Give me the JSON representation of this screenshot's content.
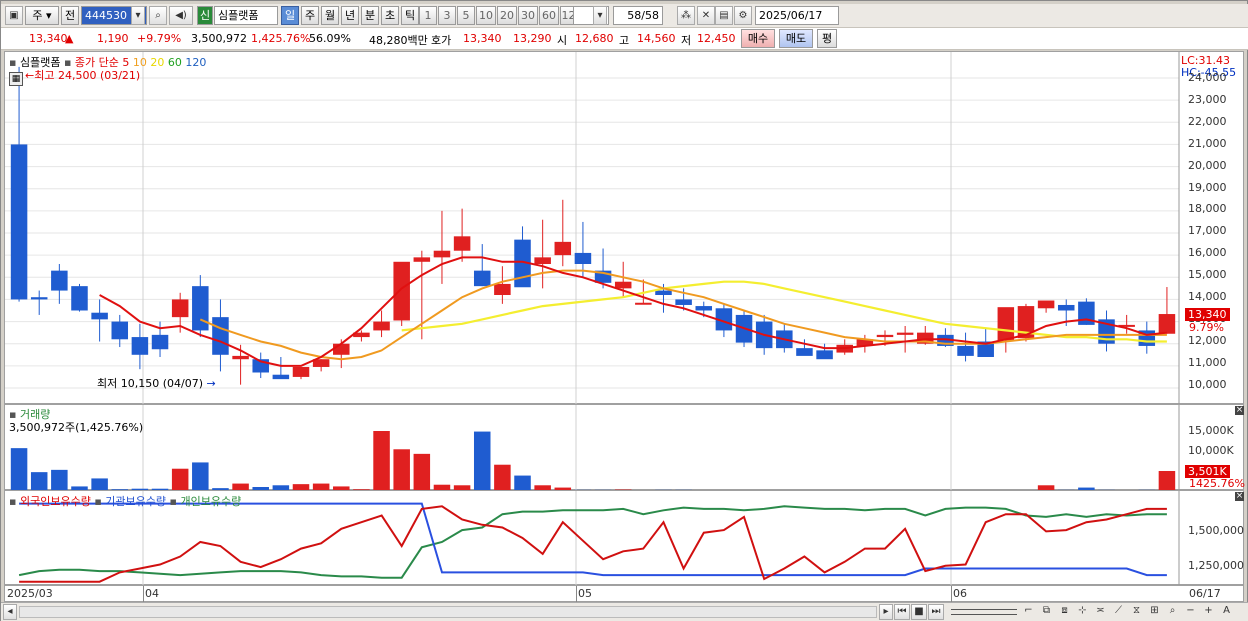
{
  "toolbar": {
    "period_label": "주",
    "prev_label": "전",
    "code": "444530",
    "stock_badge": "신",
    "stock_name": "심플랫폼",
    "period_buttons": [
      "일",
      "주",
      "월",
      "년",
      "분",
      "초",
      "틱"
    ],
    "interval_buttons": [
      "1",
      "3",
      "5",
      "10",
      "20",
      "30",
      "60",
      "120"
    ],
    "count_display": "58/58",
    "date": "2025/06/17"
  },
  "quote": {
    "price": "13,340",
    "change": "1,190",
    "change_pct": "+9.79%",
    "volume": "3,500,972",
    "volume_ratio": "1,425.76%",
    "turnover_ratio": "56.09%",
    "amount": "48,280백만",
    "bid_label": "호가",
    "ask": "13,340",
    "bid": "13,290",
    "open_label": "시",
    "open": "12,680",
    "high_label": "고",
    "high": "14,560",
    "low_label": "저",
    "low": "12,450",
    "buy_button": "매수",
    "sell_button": "매도",
    "eval_button": "평"
  },
  "price_panel": {
    "title": "심플랫폼",
    "legend_prefix": "종가 단순",
    "ma_labels": [
      "5",
      "10",
      "20",
      "60",
      "120"
    ],
    "ma_colors": [
      "#e00000",
      "#f0a020",
      "#f0e020",
      "#20a020",
      "#2060c0"
    ],
    "lc": "LC:31.43",
    "hc": "HC:-45.55",
    "high_note": "최고 24,500 (03/21)",
    "low_note": "최저 10,150 (04/07)",
    "ticks": [
      "24,000",
      "23,000",
      "22,000",
      "21,000",
      "20,000",
      "19,000",
      "18,000",
      "17,000",
      "16,000",
      "15,000",
      "14,000",
      "13,000",
      "12,000",
      "11,000",
      "10,000"
    ],
    "current_tag": "13,340",
    "current_pct": "9.79%"
  },
  "volume_panel": {
    "title": "거래량",
    "value_note": "3,500,972주(1,425.76%)",
    "ticks": [
      "15,000K",
      "10,000K"
    ],
    "current_tag": "3,501K",
    "current_pct": "1425.76%"
  },
  "holdings_panel": {
    "legend": [
      "외국인보유수량",
      "기관보유수량",
      "개인보유수량"
    ],
    "ticks": [
      "1,500,000",
      "1,250,000"
    ]
  },
  "xaxis": {
    "labels": [
      "2025/03",
      "04",
      "05",
      "06"
    ],
    "end_label": "06/17"
  },
  "chart_data": {
    "type": "candlestick",
    "dates": [
      "03/21",
      "03/24",
      "03/25",
      "03/26",
      "03/27",
      "03/28",
      "03/31",
      "04/01",
      "04/02",
      "04/03",
      "04/04",
      "04/07",
      "04/08",
      "04/09",
      "04/10",
      "04/11",
      "04/14",
      "04/15",
      "04/16",
      "04/17",
      "04/18",
      "04/21",
      "04/22",
      "04/23",
      "04/24",
      "04/25",
      "04/28",
      "04/29",
      "04/30",
      "05/02",
      "05/07",
      "05/08",
      "05/09",
      "05/12",
      "05/13",
      "05/14",
      "05/15",
      "05/16",
      "05/19",
      "05/20",
      "05/21",
      "05/22",
      "05/23",
      "05/26",
      "05/27",
      "05/28",
      "05/29",
      "05/30",
      "06/02",
      "06/04",
      "06/05",
      "06/09",
      "06/10",
      "06/11",
      "06/12",
      "06/13",
      "06/16",
      "06/17"
    ],
    "open": [
      21000,
      14100,
      15300,
      14600,
      13400,
      13000,
      12300,
      12400,
      13200,
      14600,
      13200,
      11300,
      11300,
      10600,
      10500,
      10950,
      11500,
      12300,
      12600,
      13050,
      15700,
      15900,
      16200,
      15300,
      14200,
      16700,
      15600,
      16000,
      16100,
      15300,
      14500,
      13800,
      14400,
      14000,
      13700,
      13600,
      13300,
      13000,
      12600,
      11800,
      11700,
      11600,
      11900,
      12300,
      12400,
      12000,
      12400,
      11900,
      12100,
      12150,
      12250,
      13600,
      13750,
      13900,
      13100,
      12850,
      12600,
      12450
    ],
    "high": [
      24500,
      14400,
      15600,
      14700,
      14000,
      13300,
      12900,
      13000,
      14300,
      15100,
      14000,
      11950,
      11600,
      11400,
      10950,
      11300,
      12200,
      12600,
      13500,
      14500,
      16200,
      18000,
      18100,
      16500,
      15500,
      17300,
      17600,
      18500,
      17500,
      16300,
      15700,
      14900,
      14700,
      14500,
      13900,
      13800,
      13500,
      13300,
      12900,
      12200,
      12000,
      12200,
      12400,
      12600,
      12800,
      12800,
      12700,
      12500,
      12700,
      12300,
      13800,
      13900,
      14000,
      14050,
      13500,
      13300,
      13000,
      14560
    ],
    "low": [
      13900,
      13300,
      13800,
      13450,
      12100,
      11850,
      10850,
      11400,
      12500,
      12300,
      10750,
      10150,
      10450,
      10450,
      10400,
      10750,
      10900,
      12100,
      12300,
      12800,
      12200,
      14700,
      15700,
      14600,
      13800,
      14600,
      14500,
      15500,
      15000,
      14500,
      14100,
      13800,
      13400,
      13500,
      13200,
      12300,
      11850,
      11500,
      11600,
      11500,
      11400,
      11500,
      11600,
      11900,
      11600,
      11950,
      11850,
      11200,
      12050,
      11600,
      12100,
      13400,
      12800,
      12850,
      11650,
      12450,
      11550,
      12450
    ],
    "close": [
      14000,
      14000,
      14400,
      13500,
      13100,
      12200,
      11500,
      11750,
      14000,
      12600,
      11500,
      11450,
      10700,
      10400,
      10950,
      11300,
      12000,
      12500,
      13000,
      15700,
      15900,
      16200,
      16850,
      14600,
      14700,
      14550,
      15900,
      16600,
      15600,
      14750,
      14800,
      13850,
      14200,
      13750,
      13500,
      12600,
      12050,
      11800,
      11800,
      11450,
      11300,
      11950,
      12200,
      12400,
      12500,
      12500,
      11900,
      11450,
      11400,
      13650,
      13700,
      13950,
      13500,
      12850,
      12000,
      12850,
      11900,
      13340
    ],
    "volume": [
      7500,
      3300,
      3700,
      800,
      2200,
      300,
      400,
      400,
      3900,
      5000,
      500,
      1300,
      700,
      1000,
      1200,
      1300,
      800,
      300,
      10500,
      7300,
      6500,
      1100,
      1000,
      10400,
      4600,
      2700,
      1000,
      600,
      200,
      200,
      250,
      150,
      200,
      200,
      150,
      150,
      150,
      150,
      150,
      150,
      150,
      150,
      150,
      150,
      150,
      150,
      150,
      150,
      150,
      150,
      150,
      1000,
      200,
      600,
      200,
      150,
      200,
      3501
    ],
    "ma5": [
      null,
      null,
      null,
      null,
      14200,
      13700,
      13000,
      12700,
      12800,
      12400,
      12100,
      11700,
      11200,
      11000,
      11000,
      11400,
      12000,
      12700,
      13600,
      14500,
      15100,
      15600,
      15900,
      15900,
      15700,
      15700,
      15500,
      15200,
      15000,
      14700,
      14400,
      14100,
      13800,
      13600,
      13300,
      13000,
      12700,
      12400,
      12200,
      12000,
      11800,
      11800,
      11900,
      12000,
      12100,
      12200,
      12200,
      12100,
      12000,
      12200,
      12400,
      12800,
      13000,
      13100,
      12900,
      12700,
      12400,
      12500
    ],
    "ma10": [
      null,
      null,
      null,
      null,
      null,
      null,
      null,
      null,
      null,
      13100,
      12700,
      12400,
      12100,
      11900,
      11600,
      11400,
      11300,
      11400,
      11700,
      12300,
      12900,
      13500,
      14100,
      14500,
      14800,
      15000,
      15200,
      15300,
      15300,
      15200,
      15000,
      14800,
      14500,
      14300,
      14100,
      13800,
      13500,
      13200,
      12900,
      12700,
      12500,
      12300,
      12200,
      12100,
      12100,
      12100,
      12000,
      12000,
      12000,
      12100,
      12200,
      12300,
      12400,
      12400,
      12400,
      12400,
      12400,
      12400
    ],
    "ma20": [
      null,
      null,
      null,
      null,
      null,
      null,
      null,
      null,
      null,
      null,
      null,
      null,
      null,
      null,
      null,
      null,
      null,
      null,
      null,
      12600,
      12700,
      12800,
      12900,
      13100,
      13300,
      13500,
      13700,
      13800,
      13900,
      14000,
      14100,
      14300,
      14500,
      14600,
      14700,
      14800,
      14800,
      14700,
      14500,
      14300,
      14100,
      13900,
      13700,
      13500,
      13300,
      13100,
      12900,
      12800,
      12700,
      12600,
      12500,
      12400,
      12300,
      12300,
      12200,
      12200,
      12100,
      12100
    ],
    "foreign_hold": [
      1150000,
      1150000,
      1150000,
      1150000,
      1150000,
      1220000,
      1250000,
      1280000,
      1340000,
      1450000,
      1420000,
      1300000,
      1260000,
      1320000,
      1400000,
      1440000,
      1550000,
      1600000,
      1650000,
      1420000,
      1700000,
      1720000,
      1620000,
      1580000,
      1560000,
      1480000,
      1360000,
      1600000,
      1460000,
      1320000,
      1380000,
      1400000,
      1600000,
      1250000,
      1520000,
      1540000,
      1640000,
      1170000,
      1250000,
      1340000,
      1220000,
      1300000,
      1400000,
      1400000,
      1550000,
      1230000,
      1270000,
      1280000,
      1600000,
      1660000,
      1660000,
      1530000,
      1540000,
      1600000,
      1620000,
      1660000,
      1700000,
      1700000
    ],
    "inst_hold": [
      1740000,
      1740000,
      1740000,
      1740000,
      1740000,
      1740000,
      1740000,
      1740000,
      1740000,
      1740000,
      1740000,
      1740000,
      1740000,
      1740000,
      1740000,
      1740000,
      1740000,
      1740000,
      1740000,
      1740000,
      1740000,
      1220000,
      1220000,
      1220000,
      1220000,
      1220000,
      1220000,
      1220000,
      1220000,
      1200000,
      1200000,
      1200000,
      1200000,
      1200000,
      1200000,
      1200000,
      1200000,
      1200000,
      1200000,
      1200000,
      1200000,
      1200000,
      1200000,
      1200000,
      1200000,
      1250000,
      1250000,
      1250000,
      1250000,
      1250000,
      1250000,
      1250000,
      1250000,
      1250000,
      1250000,
      1250000,
      1200000,
      1200000
    ],
    "retail_hold": [
      1200000,
      1230000,
      1240000,
      1240000,
      1230000,
      1230000,
      1220000,
      1210000,
      1200000,
      1210000,
      1220000,
      1230000,
      1230000,
      1230000,
      1220000,
      1200000,
      1190000,
      1190000,
      1180000,
      1180000,
      1410000,
      1450000,
      1540000,
      1560000,
      1660000,
      1680000,
      1680000,
      1690000,
      1690000,
      1690000,
      1700000,
      1660000,
      1690000,
      1710000,
      1700000,
      1700000,
      1690000,
      1700000,
      1720000,
      1710000,
      1700000,
      1700000,
      1690000,
      1700000,
      1700000,
      1650000,
      1700000,
      1710000,
      1710000,
      1700000,
      1650000,
      1640000,
      1660000,
      1640000,
      1660000,
      1650000,
      1660000,
      1660000
    ]
  }
}
